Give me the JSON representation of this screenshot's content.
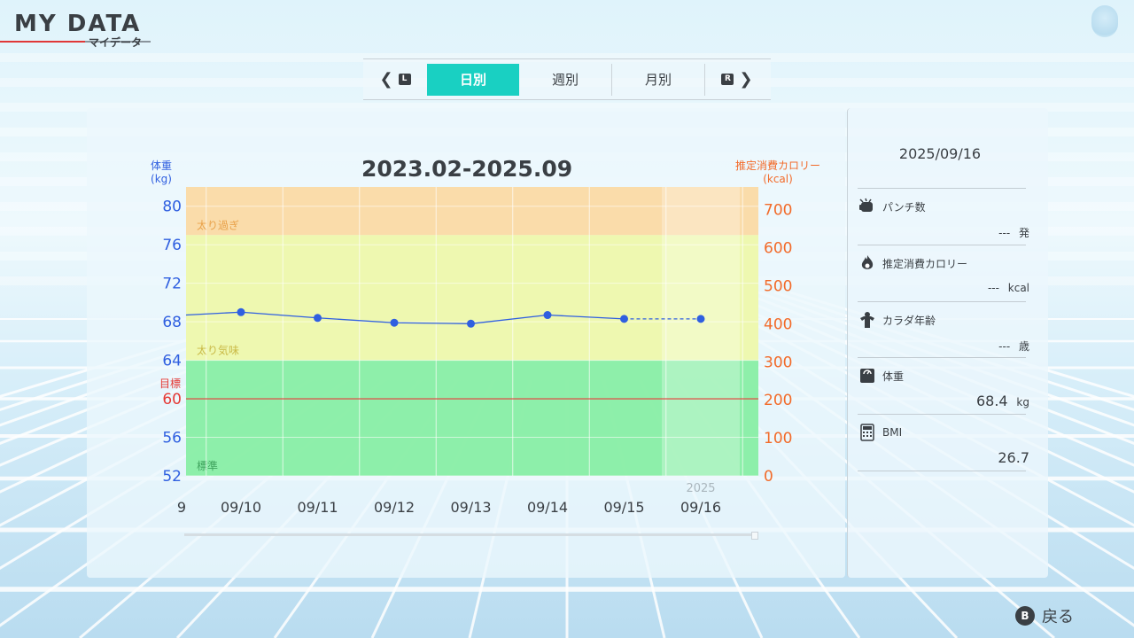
{
  "header": {
    "title": "MY DATA",
    "subtitle": "マイデータ"
  },
  "tabs": {
    "prev_key": "L",
    "next_key": "R",
    "items": [
      {
        "label": "日別",
        "active": true
      },
      {
        "label": "週別",
        "active": false
      },
      {
        "label": "月別",
        "active": false
      }
    ]
  },
  "chart_data": {
    "type": "line",
    "title": "2023.02-2025.09",
    "y_left_label": "体重\n(kg)",
    "y_right_label": "推定消費カロリー\n(kcal)",
    "y_left_ticks": [
      "80",
      "76",
      "72",
      "68",
      "64",
      "60",
      "56",
      "52"
    ],
    "y_right_ticks": [
      "700",
      "600",
      "500",
      "400",
      "300",
      "200",
      "100",
      "0"
    ],
    "ylim_left": [
      52,
      82
    ],
    "ylim_right": [
      0,
      760
    ],
    "x_partial_label": "9",
    "categories": [
      "09/10",
      "09/11",
      "09/12",
      "09/13",
      "09/14",
      "09/15",
      "09/16"
    ],
    "year_label": "2025",
    "series": [
      {
        "values": [
          69.0,
          68.4,
          67.9,
          67.8,
          68.7,
          68.3,
          68.3
        ],
        "color": "#2f5fe0"
      }
    ],
    "lead_in_value": 68.7,
    "target": {
      "label": "目標",
      "value": 60,
      "color": "#e53935"
    },
    "zones": [
      {
        "label": "太り過ぎ",
        "from": 77,
        "to": 82,
        "color": "#fbd9a3",
        "text_color": "#e9a24a"
      },
      {
        "label": "太り気味",
        "from": 64,
        "to": 77,
        "color": "#eef7a9",
        "text_color": "#c9b946"
      },
      {
        "label": "標準",
        "from": 52,
        "to": 64,
        "color": "#86eea3",
        "text_color": "#3fa35d"
      }
    ],
    "grid": true
  },
  "side": {
    "date": "2025/09/16",
    "stats": [
      {
        "icon": "punch-icon",
        "label": "パンチ数",
        "value": "---",
        "unit": "発"
      },
      {
        "icon": "calorie-flame-icon",
        "label": "推定消費カロリー",
        "value": "---",
        "unit": "kcal"
      },
      {
        "icon": "body-age-icon",
        "label": "カラダ年齢",
        "value": "---",
        "unit": "歳"
      },
      {
        "icon": "scale-icon",
        "label": "体重",
        "value": "68.4",
        "unit": "kg"
      },
      {
        "icon": "calculator-icon",
        "label": "BMI",
        "value": "26.7",
        "unit": ""
      }
    ]
  },
  "footer": {
    "back_key": "B",
    "back_label": "戻る"
  },
  "colors": {
    "accent": "#19d0c2",
    "weight_axis": "#2f5fe0",
    "calorie_axis": "#f26b2a",
    "target": "#e53935"
  }
}
